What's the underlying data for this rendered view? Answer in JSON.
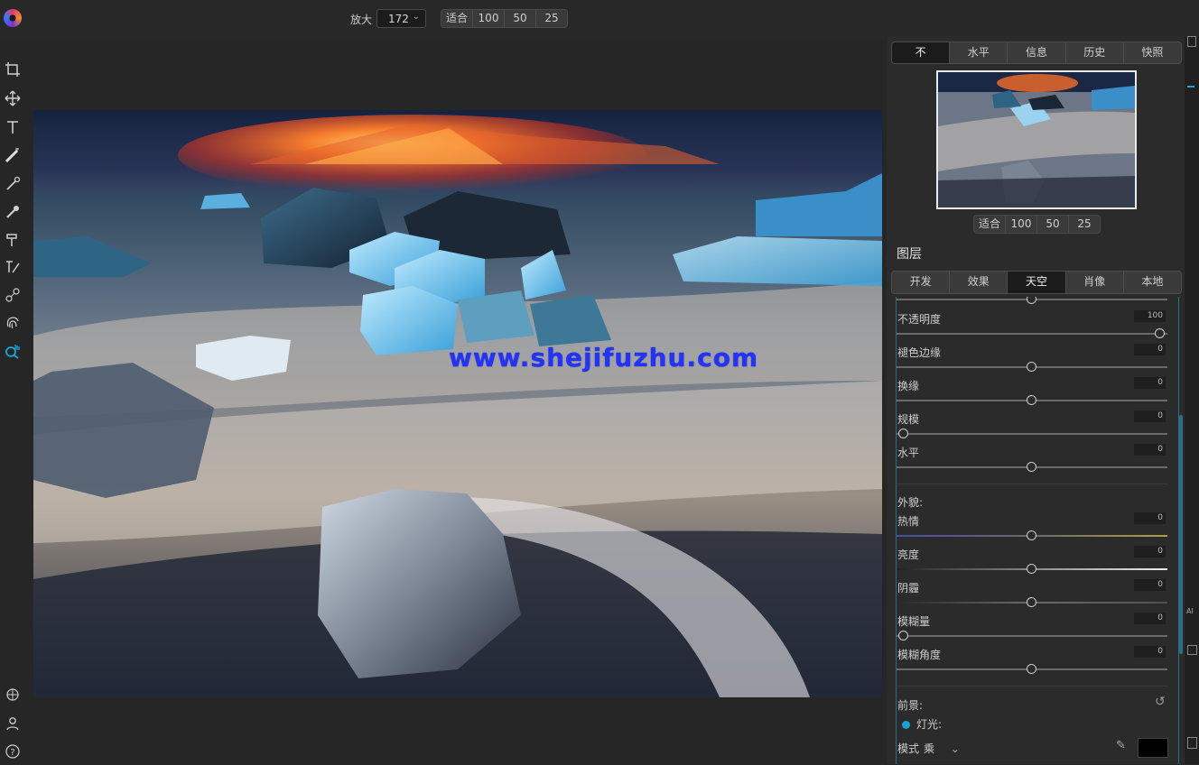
{
  "toolbar": {
    "zoom_label": "放大",
    "zoom_value": "172",
    "zoom_options": [
      "适合",
      "100",
      "50",
      "25"
    ]
  },
  "tools": [
    {
      "icon": "crop-icon"
    },
    {
      "icon": "move-icon"
    },
    {
      "icon": "text-icon"
    },
    {
      "icon": "magic-wand-icon"
    },
    {
      "icon": "brush-icon"
    },
    {
      "icon": "healing-brush-icon"
    },
    {
      "icon": "clone-brush-icon"
    },
    {
      "icon": "eraser-brush-icon"
    },
    {
      "icon": "gradient-icon"
    },
    {
      "icon": "fingerprint-icon"
    },
    {
      "icon": "search-hand-icon"
    }
  ],
  "bottom_tools": [
    "layers-shapes-icon",
    "user-icon",
    "help-icon"
  ],
  "panel": {
    "top_tabs": [
      "不",
      "水平",
      "信息",
      "历史",
      "快照"
    ],
    "active_top_tab": 0,
    "nav_zoom_options": [
      "适合",
      "100",
      "50",
      "25"
    ],
    "layers_label": "图层",
    "sub_tabs": [
      "开发",
      "效果",
      "天空",
      "肖像",
      "本地"
    ],
    "active_sub_tab": 2,
    "sliders": [
      {
        "label": "不透明度",
        "value": "100",
        "level": 1.0
      },
      {
        "label": "褪色边缘",
        "value": "0",
        "level": 0.5
      },
      {
        "label": "换缘",
        "value": "0",
        "level": 0.5
      },
      {
        "label": "规模",
        "value": "0",
        "level": 0.0
      },
      {
        "label": "水平",
        "value": "0",
        "level": 0.5
      }
    ],
    "appearance_label": "外貌:",
    "appearance_sliders": [
      {
        "label": "热情",
        "value": "0",
        "level": 0.5
      },
      {
        "label": "亮度",
        "value": "0",
        "level": 0.5
      },
      {
        "label": "阴霾",
        "value": "0",
        "level": 0.5
      },
      {
        "label": "模糊量",
        "value": "0",
        "level": 0.0
      },
      {
        "label": "模糊角度",
        "value": "0",
        "level": 0.5
      }
    ],
    "foreground_label": "前景:",
    "light_label": "灯光:",
    "mode_label": "模式",
    "mode_value": "乘"
  },
  "watermark": "www.shejifuzhu.com",
  "colors": {
    "accent": "#1aa3d9",
    "panel": "#2b2b2b",
    "background": "#262626"
  }
}
